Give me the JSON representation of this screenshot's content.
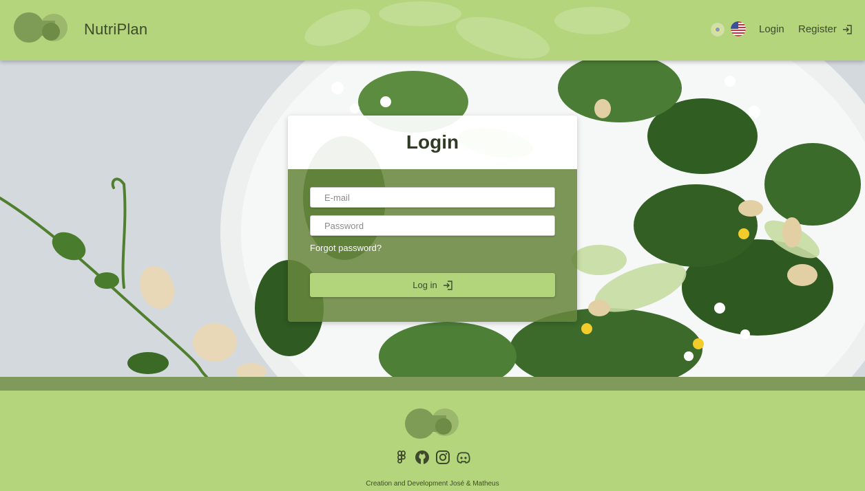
{
  "header": {
    "brand": "NutriPlan",
    "nav_login": "Login",
    "nav_register": "Register"
  },
  "login_card": {
    "title": "Login",
    "email_placeholder": "E-mail",
    "password_placeholder": "Password",
    "forgot_password": "Forgot password?",
    "submit_label": "Log in"
  },
  "footer": {
    "credit": "Creation and Development José & Matheus",
    "social_icons": [
      "figma-icon",
      "github-icon",
      "instagram-icon",
      "discord-icon"
    ]
  },
  "colors": {
    "primary_green": "#b4d57b",
    "dark_green": "#68863c",
    "text_dark": "#3d4a2c"
  }
}
